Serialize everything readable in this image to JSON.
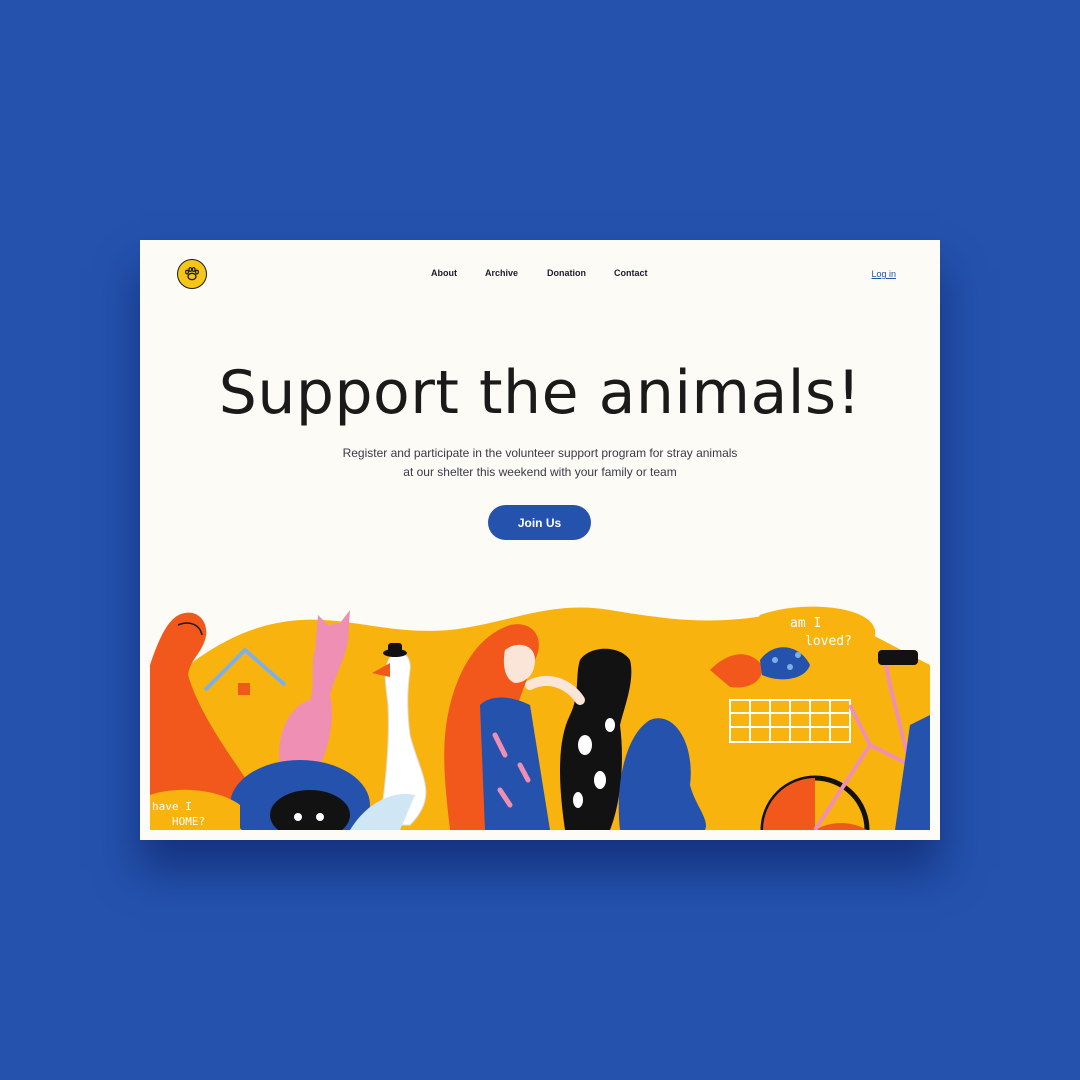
{
  "nav": {
    "items": [
      {
        "label": "About"
      },
      {
        "label": "Archive"
      },
      {
        "label": "Donation"
      },
      {
        "label": "Contact"
      }
    ],
    "login": "Log in"
  },
  "hero": {
    "title": "Support the animals!",
    "subtitle_line1": "Register and participate in the volunteer support program for stray animals",
    "subtitle_line2": "at our shelter this weekend with your family or team",
    "cta_label": "Join Us"
  },
  "illustration": {
    "bubble_text_line1": "am I",
    "bubble_text_line2": "loved?",
    "corner_text_line1": "have I",
    "corner_text_line2": "HOME?"
  },
  "colors": {
    "background": "#2452ad",
    "card": "#fcfbf5",
    "accent": "#2452ad",
    "yellow": "#f9b30f",
    "orange": "#f2581c",
    "pink": "#f08fb4"
  },
  "icons": {
    "logo": "paw-logo-icon"
  }
}
